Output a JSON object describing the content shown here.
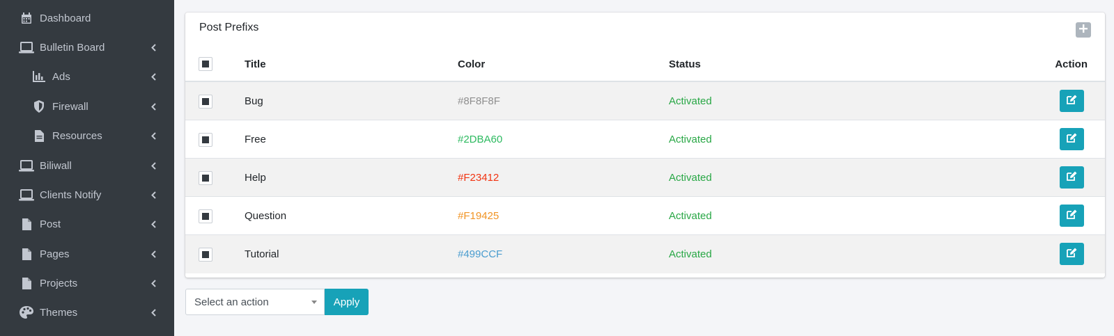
{
  "sidebar": {
    "items": [
      {
        "label": "Dashboard",
        "icon": "calendar-icon"
      },
      {
        "label": "Bulletin Board",
        "icon": "laptop-icon"
      },
      {
        "label": "Ads",
        "icon": "chart-bar-icon"
      },
      {
        "label": "Firewall",
        "icon": "shield-icon"
      },
      {
        "label": "Resources",
        "icon": "file-icon"
      },
      {
        "label": "Biliwall",
        "icon": "laptop-icon"
      },
      {
        "label": "Clients Notify",
        "icon": "laptop-icon"
      },
      {
        "label": "Post",
        "icon": "file-icon"
      },
      {
        "label": "Pages",
        "icon": "file-icon"
      },
      {
        "label": "Projects",
        "icon": "file-icon"
      },
      {
        "label": "Themes",
        "icon": "palette-icon"
      }
    ]
  },
  "card": {
    "title": "Post Prefixs",
    "headers": {
      "title": "Title",
      "color": "Color",
      "status": "Status",
      "action": "Action"
    },
    "rows": [
      {
        "title": "Bug",
        "color": "#8F8F8F",
        "status": "Activated"
      },
      {
        "title": "Free",
        "color": "#2DBA60",
        "status": "Activated"
      },
      {
        "title": "Help",
        "color": "#F23412",
        "status": "Activated"
      },
      {
        "title": "Question",
        "color": "#F19425",
        "status": "Activated"
      },
      {
        "title": "Tutorial",
        "color": "#499CCF",
        "status": "Activated"
      }
    ]
  },
  "bulk": {
    "select_value": "Select an action",
    "apply_label": "Apply"
  },
  "colors": {
    "sidebar_bg": "#343a40",
    "accent": "#17a2b8",
    "status_active": "#28a745"
  }
}
